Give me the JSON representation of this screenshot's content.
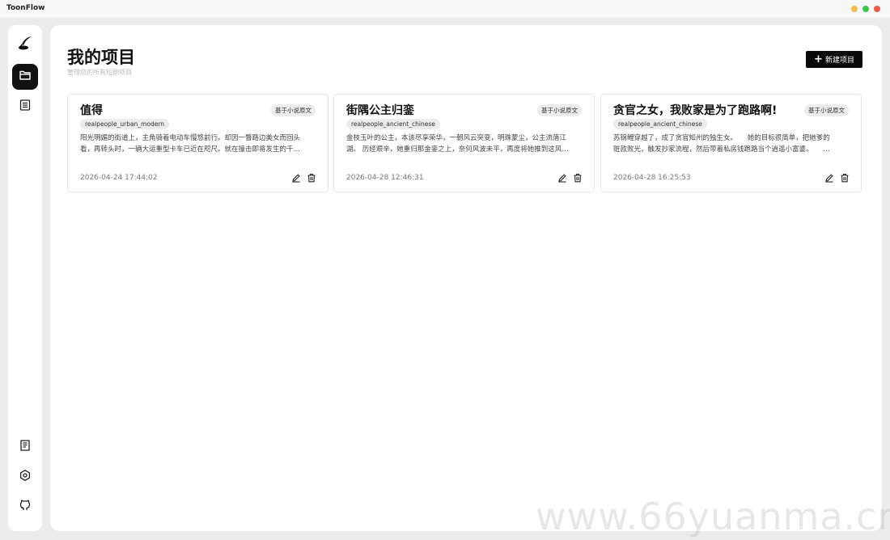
{
  "app": {
    "title": "ToonFlow",
    "window_controls": [
      {
        "name": "minimize",
        "color": "#f5be4f"
      },
      {
        "name": "maximize",
        "color": "#3fc24b"
      },
      {
        "name": "close",
        "color": "#ee5a52"
      }
    ]
  },
  "sidebar": {
    "logo_icon": "quill-ink-icon",
    "items": [
      {
        "icon": "folder-icon",
        "active": true
      },
      {
        "icon": "document-list-icon",
        "active": false
      }
    ],
    "bottom_items": [
      {
        "icon": "notes-icon"
      },
      {
        "icon": "settings-gear-icon"
      },
      {
        "icon": "github-icon"
      }
    ]
  },
  "header": {
    "title": "我的项目",
    "subtitle": "管理您的所有短剧项目",
    "new_button_icon": "plus-icon",
    "new_button_label": "新建项目"
  },
  "projects": [
    {
      "title": "值得",
      "badge": "基于小说原文",
      "tag": "realpeople_urban_modern",
      "desc_line1": "阳光明媚的街道上，主角骑着电动车慢悠前行。却因一瞥路边美女而回头",
      "desc_line2": "看，再转头时，一辆大运重型卡车已近在咫尺。就在撞击即将发生的千…",
      "date": "2026-04-24 17:44:02",
      "edit_icon": "edit-pencil-icon",
      "delete_icon": "trash-icon"
    },
    {
      "title": "街隅公主归銮",
      "badge": "基于小说原文",
      "tag": "realpeople_ancient_chinese",
      "desc_line1": "金枝玉叶的公主，本该尽享荣华，一朝风云突变，明珠蒙尘，公主流落江",
      "desc_line2": "湖。 历经艰辛，她重归那金銮之上，奈何风波未平，再度将她推到这风…",
      "date": "2026-04-28 12:46:31",
      "edit_icon": "edit-pencil-icon",
      "delete_icon": "trash-icon"
    },
    {
      "title": "贪官之女，我败家是为了跑路啊!",
      "badge": "基于小说原文",
      "tag": "realpeople_ancient_chinese",
      "desc_line1": "苏锦鲤穿越了，成了贪官知州的独生女。　　她的目标很简单，把她爹的",
      "desc_line2": "赃款败光，触发抄家流程，然后带着私房钱跑路当个逍遥小富婆。　　…",
      "date": "2026-04-28 16:25:53",
      "edit_icon": "edit-pencil-icon",
      "delete_icon": "trash-icon"
    }
  ],
  "watermark": "www.66yuanma.cn"
}
